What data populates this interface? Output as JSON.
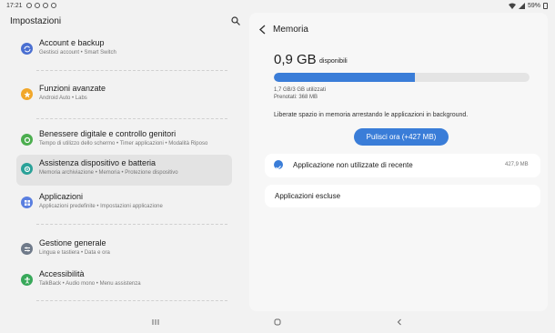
{
  "status_bar": {
    "time": "17:21",
    "battery": "59%"
  },
  "left": {
    "title": "Impostazioni",
    "items": [
      {
        "title": "Account e backup",
        "subtitle": "Gestisci account  •  Smart Switch",
        "icon": "sync-icon",
        "color": "#4a6fd1"
      },
      {
        "title": "Funzioni avanzate",
        "subtitle": "Android Auto  •  Labs",
        "icon": "star-icon",
        "color": "#f1a72a"
      },
      {
        "title": "Benessere digitale e controllo genitori",
        "subtitle": "Tempo di utilizzo dello schermo  •  Timer applicazioni  •  Modalità Riposo",
        "icon": "leaf-icon",
        "color": "#4cae4f"
      },
      {
        "title": "Assistenza dispositivo e batteria",
        "subtitle": "Memoria archiviazione  •  Memoria  •  Protezione dispositivo",
        "icon": "care-icon",
        "color": "#2aa198"
      },
      {
        "title": "Applicazioni",
        "subtitle": "Applicazioni predefinite  •  Impostazioni applicazione",
        "icon": "apps-icon",
        "color": "#5a7fe0"
      },
      {
        "title": "Gestione generale",
        "subtitle": "Lingua e tastiera  •  Data e ora",
        "icon": "sliders-icon",
        "color": "#6f7a8a"
      },
      {
        "title": "Accessibilità",
        "subtitle": "TalkBack  •  Audio mono  •  Menu assistenza",
        "icon": "accessibility-icon",
        "color": "#38a85a"
      }
    ]
  },
  "right": {
    "title": "Memoria",
    "available_value": "0,9 GB",
    "available_label": "disponibili",
    "usage_fraction": 0.55,
    "used_text": "1,7 GB/3 GB utilizzati",
    "reserved_text": "Prenotati: 368 MB",
    "description": "Liberate spazio in memoria arrestando le applicazioni in background.",
    "clean_button": "Pulisci ora (+427 MB)",
    "unused_apps_label": "Applicazione non utilizzate di recente",
    "unused_apps_size": "427,9 MB",
    "excluded_label": "Applicazioni escluse",
    "accent": "#3a7dd8"
  }
}
